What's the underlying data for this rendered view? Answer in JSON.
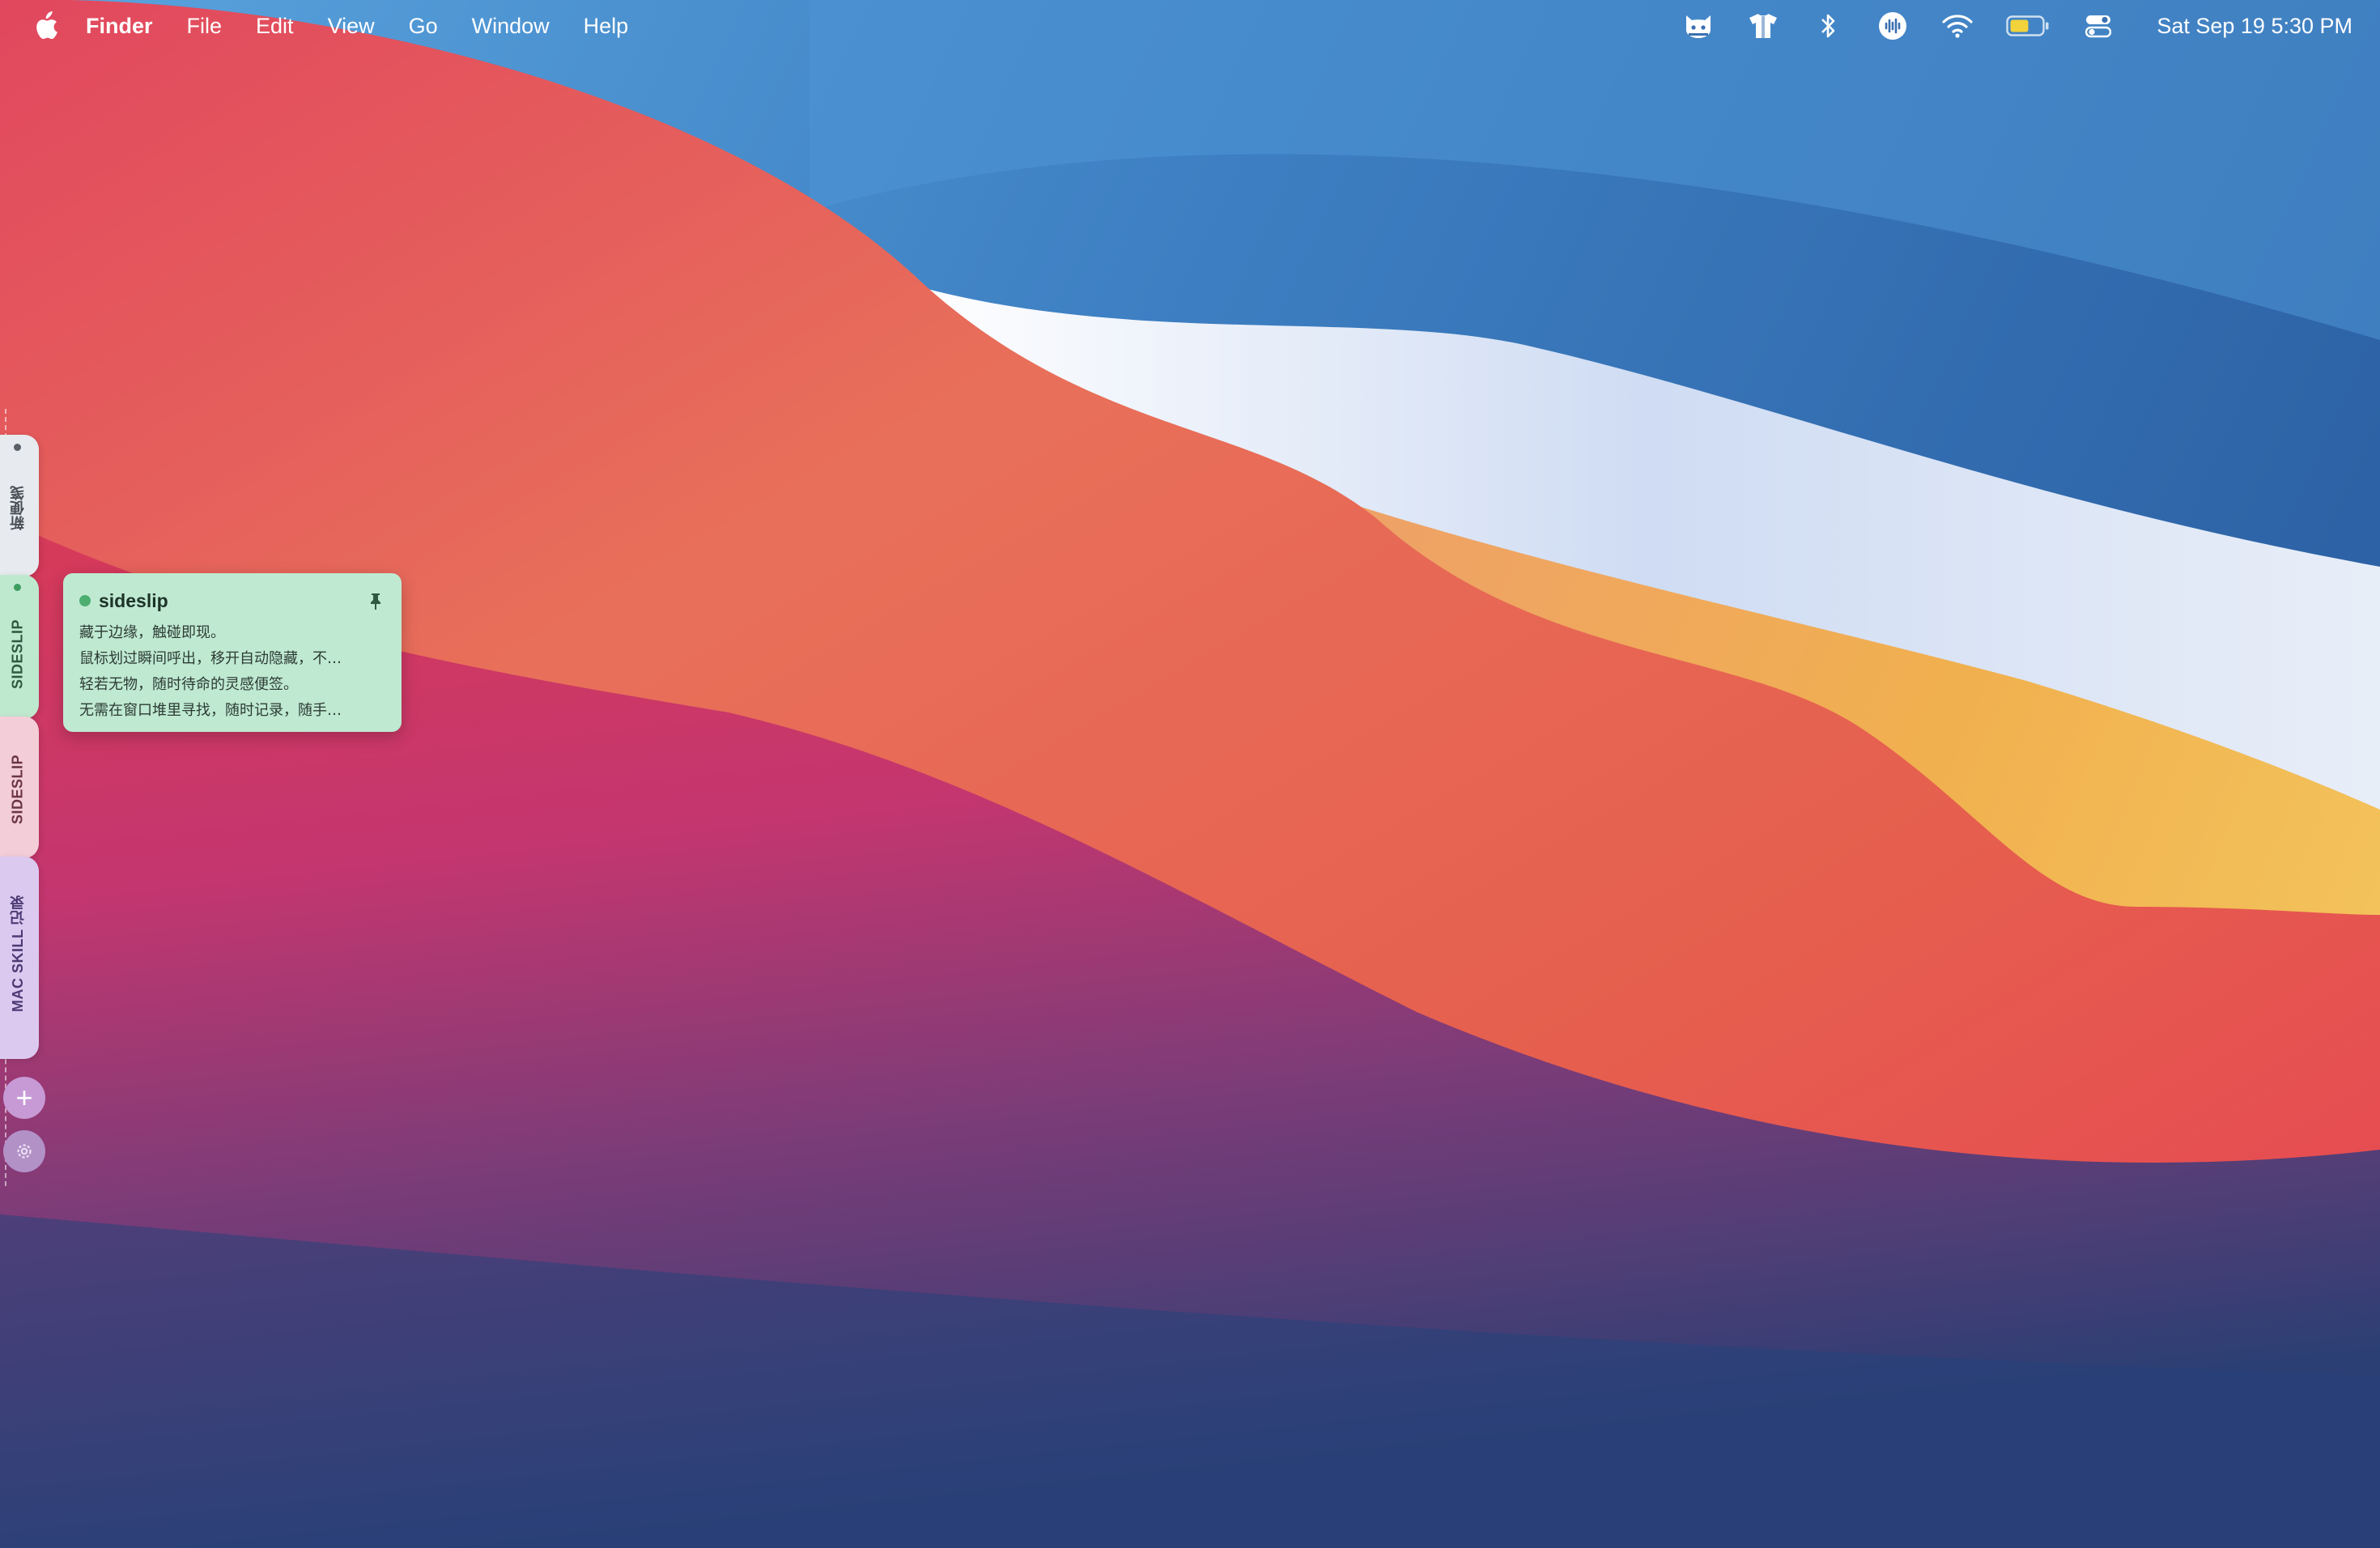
{
  "menubar": {
    "apple_icon": "apple-logo-icon",
    "app_name": "Finder",
    "menus": [
      "File",
      "Edit",
      "View",
      "Go",
      "Window",
      "Help"
    ],
    "status_icons": [
      "cat-face-icon",
      "tshirt-icon",
      "bluetooth-icon",
      "audio-wave-icon",
      "wifi-icon",
      "battery-icon",
      "control-center-icon"
    ],
    "clock": "Sat Sep 19  5:30 PM"
  },
  "sideslip": {
    "tabs": [
      {
        "label": "新便笺",
        "color": "#e7eaee"
      },
      {
        "label": "SIDESLIP",
        "color": "#bfe9cf"
      },
      {
        "label": "SIDESLIP",
        "color": "#f3cdd7"
      },
      {
        "label": "MAC SKILL 记录",
        "color": "#dbc9f0"
      }
    ],
    "add_button": "+",
    "add_icon": "plus-icon",
    "settings_icon": "gear-icon"
  },
  "note": {
    "title": "sideslip",
    "accent": "#4caf70",
    "pin_icon": "pin-icon",
    "lines": [
      "藏于边缘，触碰即现。",
      "鼠标划过瞬间呼出，移开自动隐藏，不…",
      "轻若无物，随时待命的灵感便签。",
      "无需在窗口堆里寻找，随时记录，随手…"
    ]
  }
}
